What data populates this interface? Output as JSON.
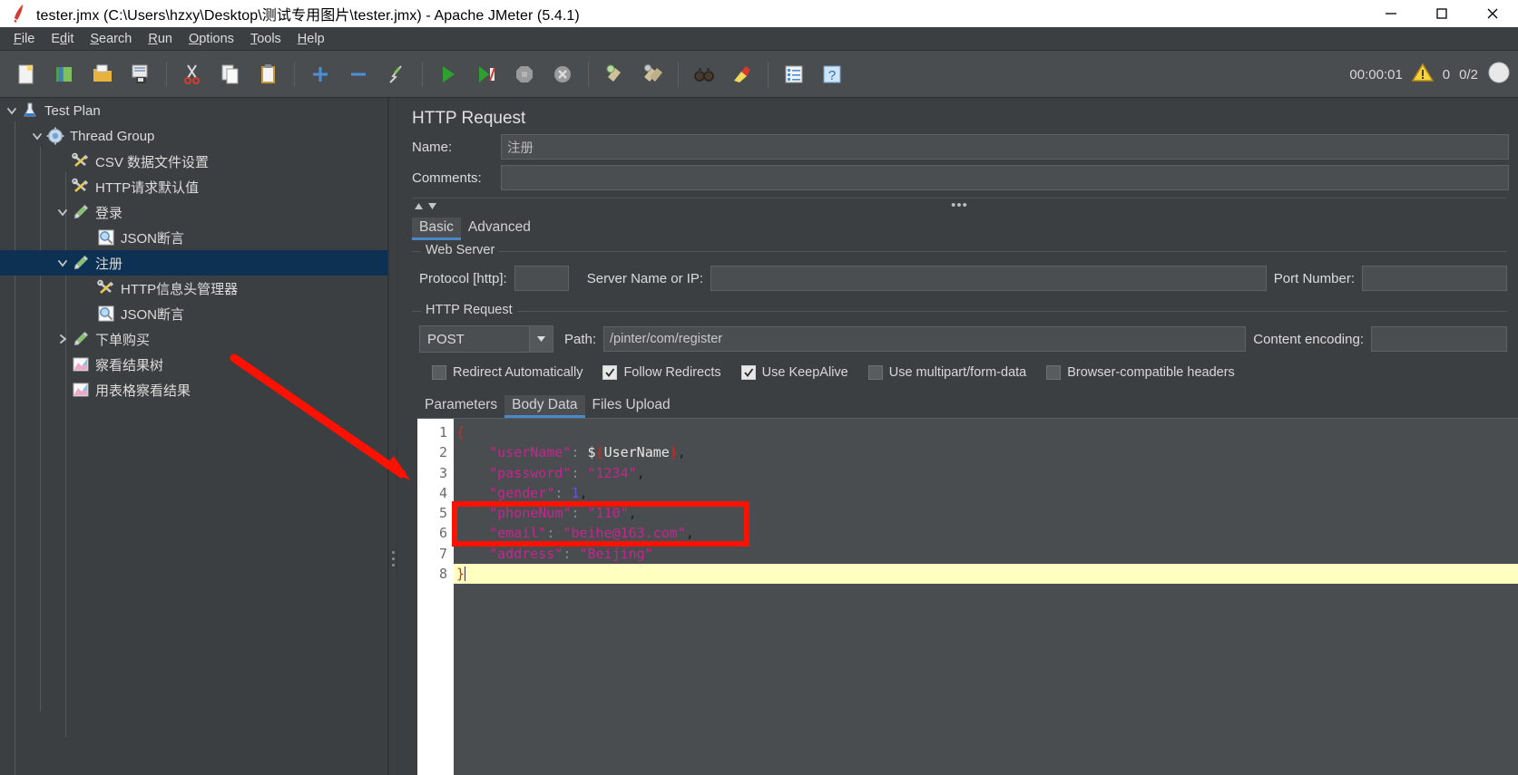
{
  "window": {
    "title": "tester.jmx (C:\\Users\\hzxy\\Desktop\\测试专用图片\\tester.jmx) - Apache JMeter (5.4.1)",
    "app_icon": "jmeter-feather-icon",
    "minimize_label": "—",
    "maximize_label": "▢",
    "close_label": "✕"
  },
  "menubar": {
    "items": [
      {
        "label": "File",
        "mnemonic": "F"
      },
      {
        "label": "Edit",
        "mnemonic": "E"
      },
      {
        "label": "Search",
        "mnemonic": "S"
      },
      {
        "label": "Run",
        "mnemonic": "R"
      },
      {
        "label": "Options",
        "mnemonic": "O"
      },
      {
        "label": "Tools",
        "mnemonic": "T"
      },
      {
        "label": "Help",
        "mnemonic": "H"
      }
    ]
  },
  "toolbar": {
    "buttons": [
      {
        "name": "new-icon"
      },
      {
        "name": "templates-icon"
      },
      {
        "name": "open-icon"
      },
      {
        "name": "save-icon"
      },
      {
        "sep": true
      },
      {
        "name": "cut-icon"
      },
      {
        "name": "copy-icon"
      },
      {
        "name": "paste-icon"
      },
      {
        "sep": true
      },
      {
        "name": "expand-all-icon"
      },
      {
        "name": "collapse-all-icon"
      },
      {
        "name": "toggle-icon"
      },
      {
        "sep": true
      },
      {
        "name": "start-icon"
      },
      {
        "name": "start-no-timers-icon"
      },
      {
        "name": "stop-icon"
      },
      {
        "name": "shutdown-icon"
      },
      {
        "sep": true
      },
      {
        "name": "clear-icon"
      },
      {
        "name": "clear-all-icon"
      },
      {
        "sep": true
      },
      {
        "name": "search-icon"
      },
      {
        "name": "reset-search-icon"
      },
      {
        "sep": true
      },
      {
        "name": "function-helper-icon"
      },
      {
        "name": "help-icon"
      }
    ],
    "elapsed_time": "00:00:01",
    "warning_icon": "warning-triangle-icon",
    "warning_count": "0",
    "threads_count": "0/2",
    "threads_icon": "threads-circle-icon"
  },
  "tree": {
    "nodes": [
      {
        "label": "Test Plan",
        "depth": 0,
        "icon": "test-plan-icon",
        "toggle": "expanded",
        "selected": false
      },
      {
        "label": "Thread Group",
        "depth": 1,
        "icon": "thread-group-icon",
        "toggle": "expanded",
        "selected": false
      },
      {
        "label": "CSV 数据文件设置",
        "depth": 2,
        "icon": "config-icon",
        "toggle": "none",
        "selected": false
      },
      {
        "label": "HTTP请求默认值",
        "depth": 2,
        "icon": "config-icon",
        "toggle": "none",
        "selected": false
      },
      {
        "label": "登录",
        "depth": 2,
        "icon": "sampler-icon",
        "toggle": "expanded",
        "selected": false
      },
      {
        "label": "JSON断言",
        "depth": 3,
        "icon": "assertion-icon",
        "toggle": "none",
        "selected": false
      },
      {
        "label": "注册",
        "depth": 2,
        "icon": "sampler-icon",
        "toggle": "expanded",
        "selected": true
      },
      {
        "label": "HTTP信息头管理器",
        "depth": 3,
        "icon": "config-icon",
        "toggle": "none",
        "selected": false
      },
      {
        "label": "JSON断言",
        "depth": 3,
        "icon": "assertion-icon",
        "toggle": "none",
        "selected": false
      },
      {
        "label": "下单购买",
        "depth": 2,
        "icon": "sampler-icon",
        "toggle": "collapsed",
        "selected": false
      },
      {
        "label": "察看结果树",
        "depth": 2,
        "icon": "listener-icon",
        "toggle": "none",
        "selected": false
      },
      {
        "label": "用表格察看结果",
        "depth": 2,
        "icon": "listener-icon",
        "toggle": "none",
        "selected": false
      }
    ]
  },
  "request": {
    "panel_title": "HTTP Request",
    "name_label": "Name:",
    "name_value": "注册",
    "comments_label": "Comments:",
    "comments_value": "",
    "tabs": [
      {
        "label": "Basic",
        "active": true
      },
      {
        "label": "Advanced",
        "active": false
      }
    ],
    "web_server": {
      "legend": "Web Server",
      "protocol_label": "Protocol [http]:",
      "protocol_value": "",
      "server_label": "Server Name or IP:",
      "server_value": "",
      "port_label": "Port Number:",
      "port_value": ""
    },
    "http_request": {
      "legend": "HTTP Request",
      "method": "POST",
      "path_label": "Path:",
      "path_value": "/pinter/com/register",
      "content_encoding_label": "Content encoding:",
      "content_encoding_value": ""
    },
    "checkboxes": [
      {
        "label": "Redirect Automatically",
        "checked": false
      },
      {
        "label": "Follow Redirects",
        "checked": true
      },
      {
        "label": "Use KeepAlive",
        "checked": true
      },
      {
        "label": "Use multipart/form-data",
        "checked": false
      },
      {
        "label": "Browser-compatible headers",
        "checked": false
      }
    ],
    "body_tabs": [
      {
        "label": "Parameters",
        "active": false
      },
      {
        "label": "Body Data",
        "active": true
      },
      {
        "label": "Files Upload",
        "active": false
      }
    ]
  },
  "editor": {
    "line_numbers": [
      "1",
      "2",
      "3",
      "4",
      "5",
      "6",
      "7",
      "8"
    ],
    "lines": [
      "{",
      "    \"userName\": ${UserName},",
      "    \"password\": \"1234\",",
      "    \"gender\": 1,",
      "    \"phoneNum\": \"110\",",
      "    \"email\": \"beihe@163.com\",",
      "    \"address\": \"Beijing\"",
      "}"
    ],
    "highlighted_line": 8,
    "fold_line": 1
  },
  "annotation": {
    "arrow_color": "#ff0000",
    "highlight_box_color": "#ff0000",
    "arrow_name": "red-pointer-arrow",
    "box_name": "red-highlight-box"
  }
}
